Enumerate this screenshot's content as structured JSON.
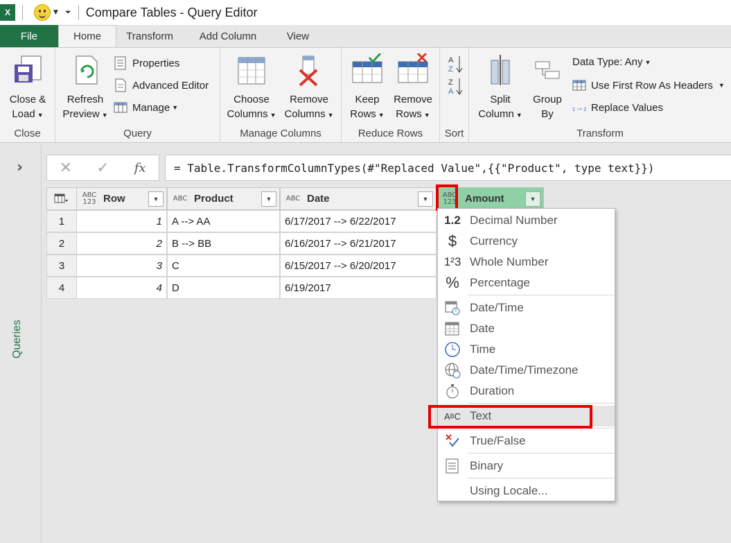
{
  "titlebar": {
    "app_icon": "excel-icon",
    "title": "Compare Tables - Query Editor"
  },
  "tabs": {
    "file": "File",
    "home": "Home",
    "transform": "Transform",
    "add_column": "Add Column",
    "view": "View"
  },
  "ribbon": {
    "close_group": {
      "label": "Close",
      "close_load_1": "Close &",
      "close_load_2": "Load"
    },
    "query_group": {
      "label": "Query",
      "refresh_1": "Refresh",
      "refresh_2": "Preview",
      "properties": "Properties",
      "advanced_editor": "Advanced Editor",
      "manage": "Manage"
    },
    "manage_columns_group": {
      "label": "Manage Columns",
      "choose_1": "Choose",
      "choose_2": "Columns",
      "remove_1": "Remove",
      "remove_2": "Columns"
    },
    "reduce_rows_group": {
      "label": "Reduce Rows",
      "keep_1": "Keep",
      "keep_2": "Rows",
      "remove_1": "Remove",
      "remove_2": "Rows"
    },
    "sort_group": {
      "label": "Sort"
    },
    "transform_group": {
      "label": "Transform",
      "split_1": "Split",
      "split_2": "Column",
      "group_1": "Group",
      "group_2": "By",
      "data_type": "Data Type: Any",
      "first_row": "Use First Row As Headers",
      "replace_values": "Replace Values"
    }
  },
  "queries_pane": {
    "label": "Queries"
  },
  "formula_bar": {
    "formula": "= Table.TransformColumnTypes(#\"Replaced Value\",{{\"Product\", type text}})"
  },
  "grid": {
    "headers": [
      {
        "name": "Row",
        "type_icon": "ABC 123"
      },
      {
        "name": "Product",
        "type_icon": "ABC"
      },
      {
        "name": "Date",
        "type_icon": "ABC"
      },
      {
        "name": "Amount",
        "type_icon": "ABC 123"
      }
    ],
    "rows": [
      {
        "n": "1",
        "row": "1",
        "product": "A --> AA",
        "date": "6/17/2017 --> 6/22/2017"
      },
      {
        "n": "2",
        "row": "2",
        "product": "B --> BB",
        "date": "6/16/2017 --> 6/21/2017"
      },
      {
        "n": "3",
        "row": "3",
        "product": "C",
        "date": "6/15/2017 --> 6/20/2017"
      },
      {
        "n": "4",
        "row": "4",
        "product": "D",
        "date": "6/19/2017"
      }
    ]
  },
  "type_menu": {
    "items": [
      {
        "label": "Decimal Number",
        "icon": "1.2"
      },
      {
        "label": "Currency",
        "icon": "$"
      },
      {
        "label": "Whole Number",
        "icon": "1²3"
      },
      {
        "label": "Percentage",
        "icon": "%"
      },
      {
        "label": "Date/Time",
        "icon": "datetime-icon"
      },
      {
        "label": "Date",
        "icon": "calendar-icon"
      },
      {
        "label": "Time",
        "icon": "clock-icon"
      },
      {
        "label": "Date/Time/Timezone",
        "icon": "globe-icon"
      },
      {
        "label": "Duration",
        "icon": "stopwatch-icon"
      },
      {
        "label": "Text",
        "icon": "text-type-icon"
      },
      {
        "label": "True/False",
        "icon": "true-false-icon"
      },
      {
        "label": "Binary",
        "icon": "binary-icon"
      },
      {
        "label": "Using Locale...",
        "icon": ""
      }
    ],
    "highlighted": "Text"
  },
  "colors": {
    "excel_green": "#217346",
    "amount_header": "#8fd0a6",
    "highlight_red": "#e60000"
  }
}
